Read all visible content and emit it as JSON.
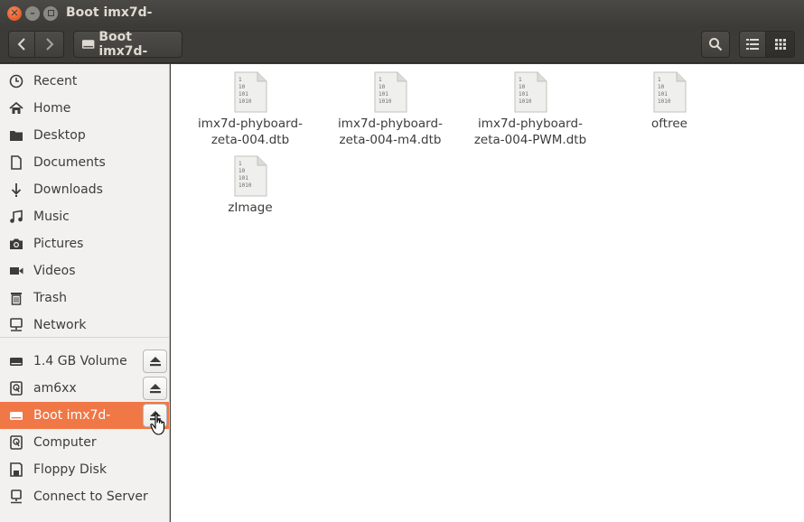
{
  "window": {
    "title": "Boot imx7d-"
  },
  "toolbar": {
    "path_label": "Boot imx7d-"
  },
  "sidebar": {
    "places": [
      {
        "label": "Recent",
        "icon": "clock-icon"
      },
      {
        "label": "Home",
        "icon": "home-icon"
      },
      {
        "label": "Desktop",
        "icon": "desktop-folder-icon"
      },
      {
        "label": "Documents",
        "icon": "document-icon"
      },
      {
        "label": "Downloads",
        "icon": "download-icon"
      },
      {
        "label": "Music",
        "icon": "music-icon"
      },
      {
        "label": "Pictures",
        "icon": "camera-icon"
      },
      {
        "label": "Videos",
        "icon": "video-icon"
      },
      {
        "label": "Trash",
        "icon": "trash-icon"
      },
      {
        "label": "Network",
        "icon": "network-icon"
      }
    ],
    "devices": [
      {
        "label": "1.4 GB Volume",
        "icon": "drive-icon",
        "eject": true
      },
      {
        "label": "am6xx",
        "icon": "harddisk-icon",
        "eject": true
      },
      {
        "label": "Boot imx7d-",
        "icon": "drive-icon",
        "eject": true,
        "active": true
      },
      {
        "label": "Computer",
        "icon": "harddisk-icon",
        "eject": false
      },
      {
        "label": "Floppy Disk",
        "icon": "floppy-icon",
        "eject": false
      },
      {
        "label": "Connect to Server",
        "icon": "server-icon",
        "eject": false
      }
    ]
  },
  "files": [
    {
      "name": "imx7d-phyboard-zeta-004.dtb"
    },
    {
      "name": "imx7d-phyboard-zeta-004-m4.dtb"
    },
    {
      "name": "imx7d-phyboard-zeta-004-PWM.dtb"
    },
    {
      "name": "oftree"
    },
    {
      "name": "zImage"
    }
  ],
  "file_icon_lines": [
    "1",
    "10",
    "101",
    "1010"
  ],
  "colors": {
    "accent": "#f07746",
    "titlebar": "#3c3b37"
  }
}
